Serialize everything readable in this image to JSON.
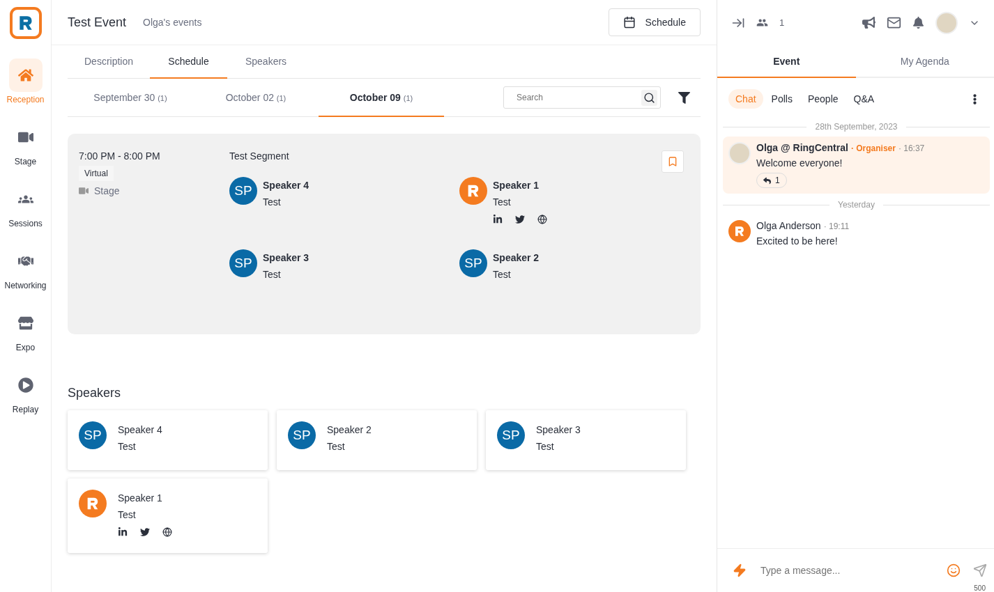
{
  "nav": {
    "items": [
      {
        "kind": "home",
        "label": "Reception",
        "selected": true
      },
      {
        "kind": "stage",
        "label": "Stage",
        "selected": false
      },
      {
        "kind": "sessions",
        "label": "Sessions",
        "selected": false
      },
      {
        "kind": "networking",
        "label": "Networking",
        "selected": false
      },
      {
        "kind": "expo",
        "label": "Expo",
        "selected": false
      },
      {
        "kind": "replay",
        "label": "Replay",
        "selected": false
      }
    ]
  },
  "header": {
    "title": "Test Event",
    "subtitle": "Olga's events",
    "button": "Schedule"
  },
  "tabs": [
    {
      "label": "Description",
      "selected": false
    },
    {
      "label": "Schedule",
      "selected": true
    },
    {
      "label": "Speakers",
      "selected": false
    }
  ],
  "date_tabs": [
    {
      "label": "September 30",
      "count": "(1)",
      "selected": false
    },
    {
      "label": "October 02",
      "count": "(1)",
      "selected": false
    },
    {
      "label": "October 09",
      "count": "(1)",
      "selected": true
    }
  ],
  "search": {
    "placeholder": "Search"
  },
  "session": {
    "time": "7:00 PM - 8:00 PM",
    "tag": "Virtual",
    "location": "Stage",
    "title": "Test Segment",
    "bookmarked": false,
    "speakers": [
      {
        "name": "Speaker 4",
        "role": "Test",
        "kind": "initials",
        "initials": "SP"
      },
      {
        "name": "Speaker 1",
        "role": "Test",
        "kind": "logo",
        "socials": [
          {
            "kind": "linkedin"
          },
          {
            "kind": "twitter"
          },
          {
            "kind": "web"
          }
        ]
      },
      {
        "name": "Speaker 3",
        "role": "Test",
        "kind": "initials",
        "initials": "SP"
      },
      {
        "name": "Speaker 2",
        "role": "Test",
        "kind": "initials",
        "initials": "SP"
      }
    ]
  },
  "speakers_section": {
    "title": "Speakers",
    "cards": [
      {
        "name": "Speaker 4",
        "role": "Test",
        "kind": "initials",
        "initials": "SP"
      },
      {
        "name": "Speaker 2",
        "role": "Test",
        "kind": "initials",
        "initials": "SP"
      },
      {
        "name": "Speaker 3",
        "role": "Test",
        "kind": "initials",
        "initials": "SP"
      },
      {
        "name": "Speaker 1",
        "role": "Test",
        "kind": "logo",
        "socials": [
          {
            "kind": "linkedin"
          },
          {
            "kind": "twitter"
          },
          {
            "kind": "web"
          }
        ]
      }
    ]
  },
  "topbar": {
    "attendees": "1"
  },
  "panel_tabs": [
    {
      "label": "Event",
      "selected": true
    },
    {
      "label": "My Agenda",
      "selected": false
    }
  ],
  "chat_tabs": [
    {
      "label": "Chat",
      "selected": true
    },
    {
      "label": "Polls",
      "selected": false
    },
    {
      "label": "People",
      "selected": false
    },
    {
      "label": "Q&A",
      "selected": false
    }
  ],
  "chat": [
    {
      "kind": "divider",
      "label": "28th September, 2023"
    },
    {
      "kind": "message",
      "avatar": {
        "kind": "photo"
      },
      "author": "Olga @ RingCentral",
      "role": "· Organiser",
      "time": "· 16:37",
      "text": "Welcome everyone!",
      "replies": "1",
      "highlighted": true
    },
    {
      "kind": "divider",
      "label": "Yesterday"
    },
    {
      "kind": "message",
      "avatar": {
        "kind": "logo"
      },
      "author": "Olga Anderson",
      "time": "· 19:11",
      "text": "Excited to be here!",
      "highlighted": false
    }
  ],
  "composer": {
    "placeholder": "Type a message...",
    "limit": "500"
  }
}
